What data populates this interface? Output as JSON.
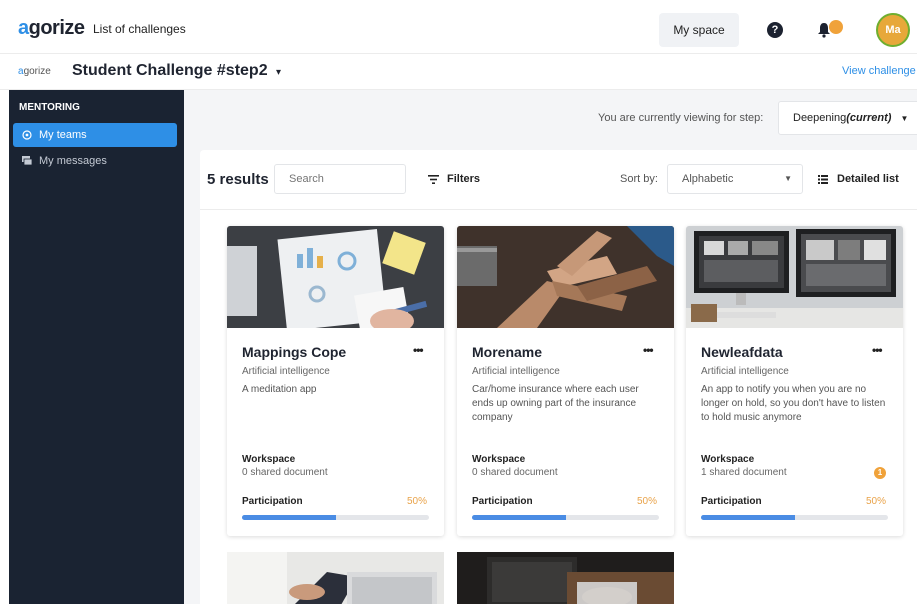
{
  "app": {
    "logo": "agorize",
    "nav_link": "List of challenges",
    "my_space_label": "My space",
    "help_icon": "question-circle-icon",
    "bell_icon": "bell-icon",
    "avatar_initials": "Ma",
    "colors": {
      "accent": "#2e8fe6",
      "sidebar": "#1a2332",
      "badge": "#f0a23a",
      "avatar_bg": "#e7a83a"
    }
  },
  "subbar": {
    "logo_small": "agorize",
    "challenge_title": "Student Challenge #step2",
    "view_challenge_label": "View challenge"
  },
  "sidebar": {
    "heading": "MENTORING",
    "items": [
      {
        "label": "My teams",
        "icon": "teams-icon",
        "active": true
      },
      {
        "label": "My messages",
        "icon": "messages-icon",
        "active": false
      }
    ]
  },
  "step": {
    "text": "You are currently viewing for step:",
    "selected": "Deepening",
    "selected_suffix": "(current)"
  },
  "toolbar": {
    "results_count": "5 results",
    "search_placeholder": "Search",
    "filters_label": "Filters",
    "sort_label": "Sort by:",
    "sort_value": "Alphabetic",
    "view_label": "Detailed list"
  },
  "cards": [
    {
      "title": "Mappings Cope",
      "category": "Artificial intelligence",
      "description": "A meditation app",
      "workspace_label": "Workspace",
      "workspace_docs": "0 shared document",
      "workspace_badge": "",
      "participation_label": "Participation",
      "participation_pct": "50%",
      "participation_value": 0.5
    },
    {
      "title": "Morename",
      "category": "Artificial intelligence",
      "description": "Car/home insurance where each user ends up owning part of the insurance company",
      "workspace_label": "Workspace",
      "workspace_docs": "0 shared document",
      "workspace_badge": "",
      "participation_label": "Participation",
      "participation_pct": "50%",
      "participation_value": 0.5
    },
    {
      "title": "Newleafdata",
      "category": "Artificial intelligence",
      "description": "An app to notify you when you are no longer on hold, so you don't have to listen to hold music anymore",
      "workspace_label": "Workspace",
      "workspace_docs": "1 shared document",
      "workspace_badge": "1",
      "participation_label": "Participation",
      "participation_pct": "50%",
      "participation_value": 0.5
    }
  ]
}
